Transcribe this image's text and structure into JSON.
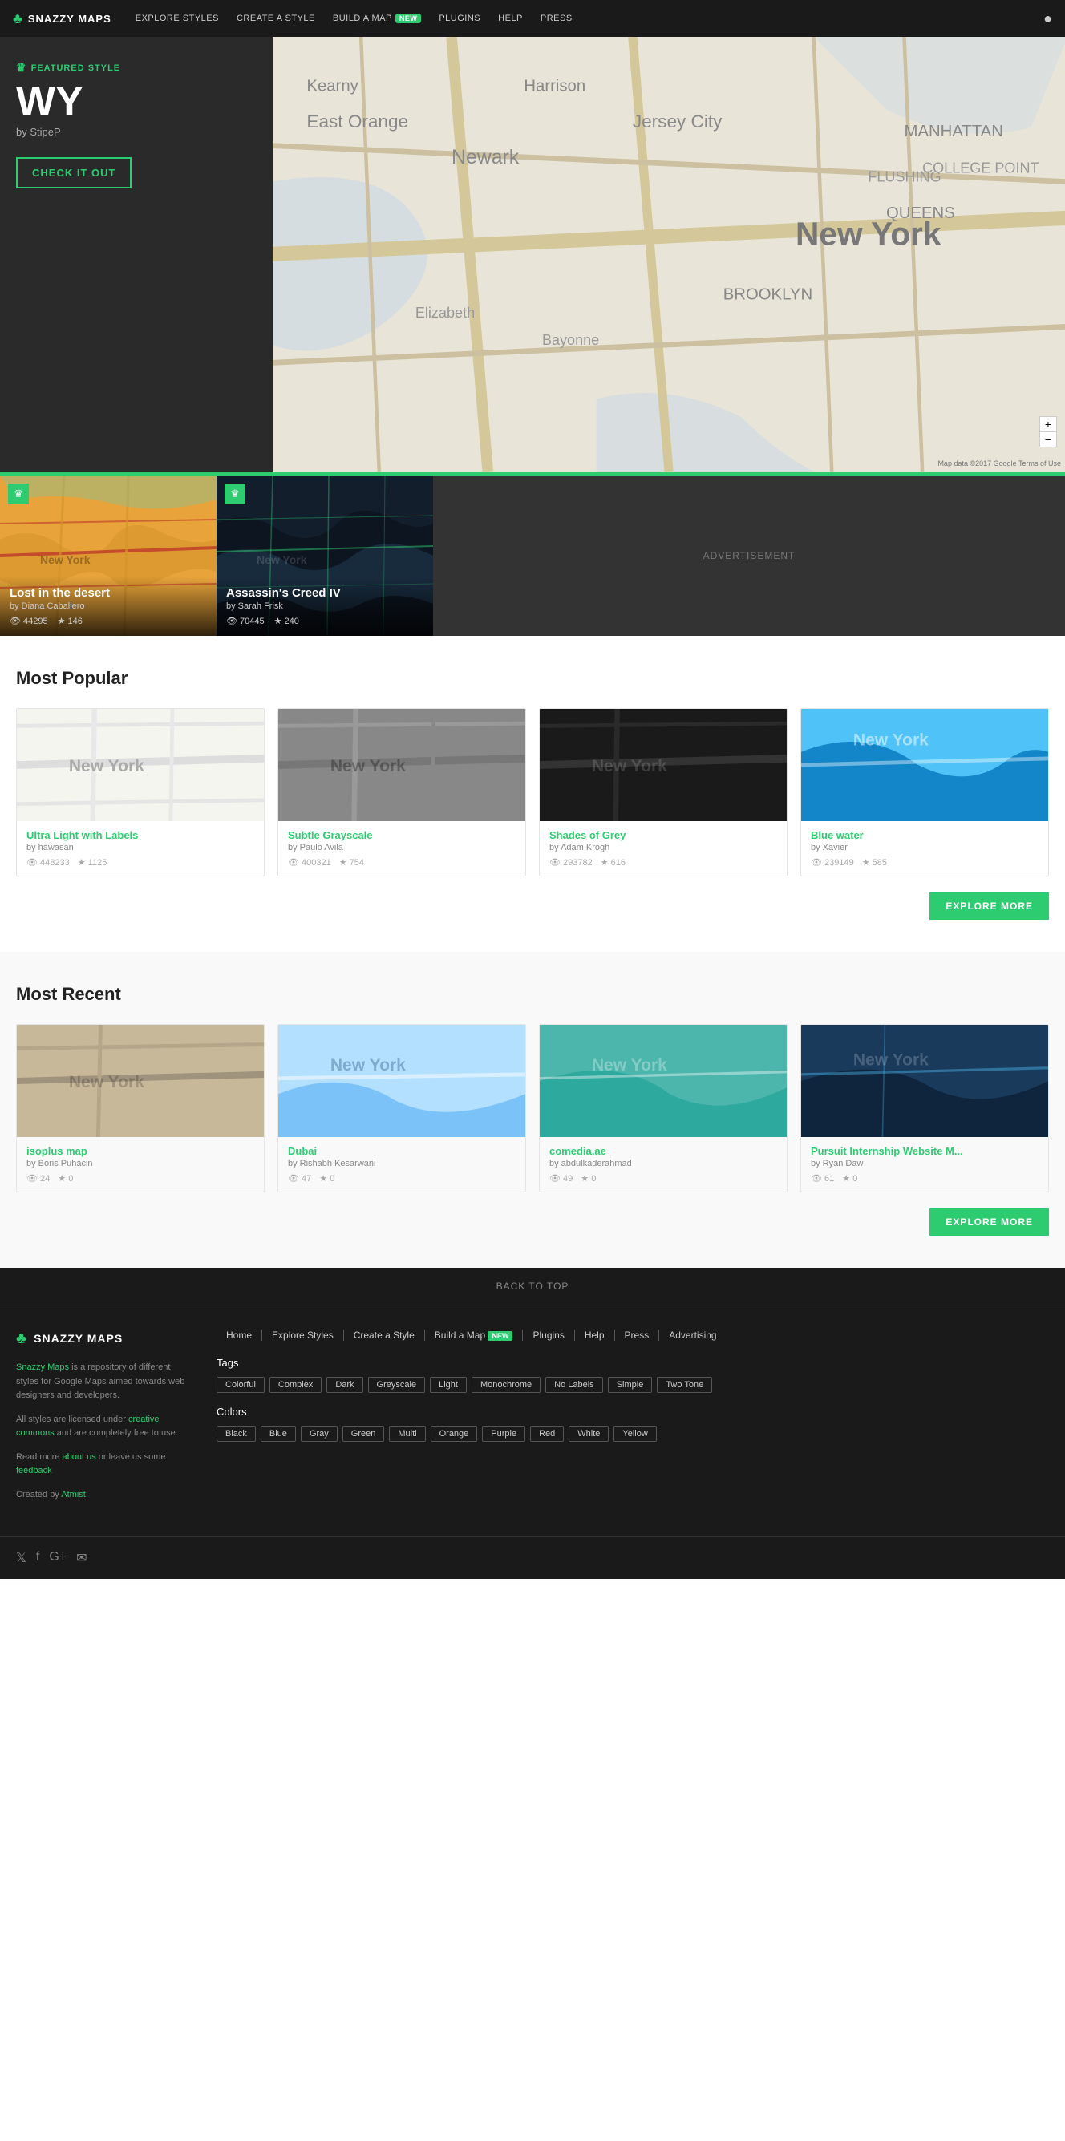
{
  "nav": {
    "logo": "SNAZZY MAPS",
    "links": [
      {
        "label": "EXPLORE STYLES",
        "id": "explore-styles"
      },
      {
        "label": "CREATE A STYLE",
        "id": "create-style"
      },
      {
        "label": "BUILD A MAP",
        "id": "build-map",
        "badge": "NEW"
      },
      {
        "label": "PLUGINS",
        "id": "plugins"
      },
      {
        "label": "HELP",
        "id": "help"
      },
      {
        "label": "PRESS",
        "id": "press"
      }
    ]
  },
  "hero": {
    "featured_label": "FEATURED STYLE",
    "title": "WY",
    "by": "by StipeP",
    "cta": "CHECK IT OUT",
    "map_attribution": "Map data ©2017 Google  Terms of Use"
  },
  "featured_cards": [
    {
      "title": "Lost in the desert",
      "by": "by Diana Caballero",
      "views": "44295",
      "stars": "146",
      "theme": "orange"
    },
    {
      "title": "Assassin's Creed IV",
      "by": "by Sarah Frisk",
      "views": "70445",
      "stars": "240",
      "theme": "dark"
    },
    {
      "type": "ad",
      "label": "ADVERTISEMENT"
    }
  ],
  "most_popular": {
    "section_title": "Most Popular",
    "explore_btn": "EXPLORE MORE",
    "items": [
      {
        "title": "Ultra Light with Labels",
        "by": "by hawasan",
        "views": "448233",
        "stars": "1125",
        "theme": "light"
      },
      {
        "title": "Subtle Grayscale",
        "by": "by Paulo Avila",
        "views": "400321",
        "stars": "754",
        "theme": "grey"
      },
      {
        "title": "Shades of Grey",
        "by": "by Adam Krogh",
        "views": "293782",
        "stars": "616",
        "theme": "dark"
      },
      {
        "title": "Blue water",
        "by": "by Xavier",
        "views": "239149",
        "stars": "585",
        "theme": "blue"
      }
    ]
  },
  "most_recent": {
    "section_title": "Most Recent",
    "explore_btn": "EXPLORE MORE",
    "items": [
      {
        "title": "isoplus map",
        "by": "by Boris Puhacin",
        "views": "24",
        "stars": "0",
        "theme": "tan"
      },
      {
        "title": "Dubai",
        "by": "by Rishabh Kesarwani",
        "views": "47",
        "stars": "0",
        "theme": "lightblue"
      },
      {
        "title": "comedia.ae",
        "by": "by abdulkaderahmad",
        "views": "49",
        "stars": "0",
        "theme": "teal"
      },
      {
        "title": "Pursuit Internship Website M...",
        "by": "by Ryan Daw",
        "views": "61",
        "stars": "0",
        "theme": "navy"
      }
    ]
  },
  "footer": {
    "back_to_top": "BACK TO TOP",
    "logo": "SNAZZY MAPS",
    "desc1": " is a repository of different styles for Google Maps aimed towards web designers and developers.",
    "desc2": "All styles are licensed under ",
    "desc3": " and are completely free to use.",
    "desc4": "Read more ",
    "desc5": " or leave us some ",
    "desc6": "Created by ",
    "creative_commons": "creative commons",
    "about": "about us",
    "feedback": "feedback",
    "atmist": "Atmist",
    "nav_links": [
      "Home",
      "Explore Styles",
      "Create a Style",
      "Build a Map",
      "Plugins",
      "Help",
      "Press",
      "Advertising"
    ],
    "build_a_map_badge": "NEW",
    "tags_title": "Tags",
    "tags": [
      "Colorful",
      "Complex",
      "Dark",
      "Greyscale",
      "Light",
      "Monochrome",
      "No Labels",
      "Simple",
      "Two Tone"
    ],
    "colors_title": "Colors",
    "colors": [
      "Black",
      "Blue",
      "Gray",
      "Green",
      "Multi",
      "Orange",
      "Purple",
      "Red",
      "White",
      "Yellow"
    ]
  }
}
